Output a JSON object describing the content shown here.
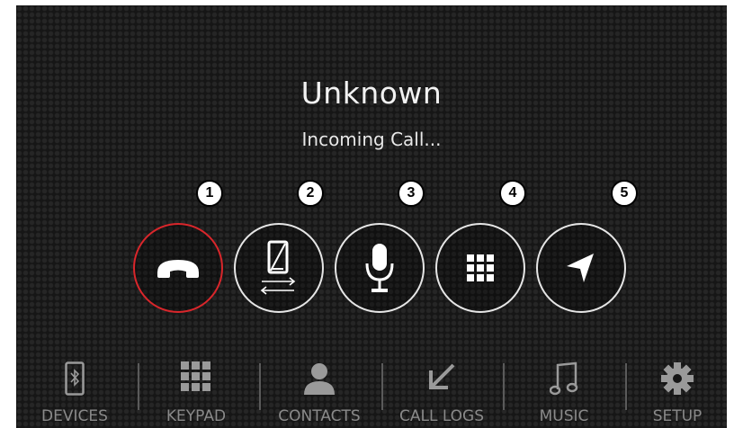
{
  "call": {
    "caller_name": "Unknown",
    "status": "Incoming Call..."
  },
  "markers": [
    "1",
    "2",
    "3",
    "4",
    "5"
  ],
  "actions": [
    {
      "icon": "end-call-icon",
      "color": "#d9262b"
    },
    {
      "icon": "transfer-to-phone-icon"
    },
    {
      "icon": "microphone-icon"
    },
    {
      "icon": "keypad-icon"
    },
    {
      "icon": "navigation-arrow-icon"
    }
  ],
  "nav": {
    "items": [
      {
        "label": "DEVICES",
        "icon": "bluetooth-phone-icon"
      },
      {
        "label": "KEYPAD",
        "icon": "keypad-grid-icon"
      },
      {
        "label": "CONTACTS",
        "icon": "person-icon"
      },
      {
        "label": "CALL LOGS",
        "icon": "call-log-arrow-icon"
      },
      {
        "label": "MUSIC",
        "icon": "music-note-icon"
      },
      {
        "label": "SETUP",
        "icon": "gear-icon"
      }
    ]
  },
  "colors": {
    "background": "#161616",
    "end_call_ring": "#d9262b",
    "nav_label": "#8a8a8a"
  }
}
